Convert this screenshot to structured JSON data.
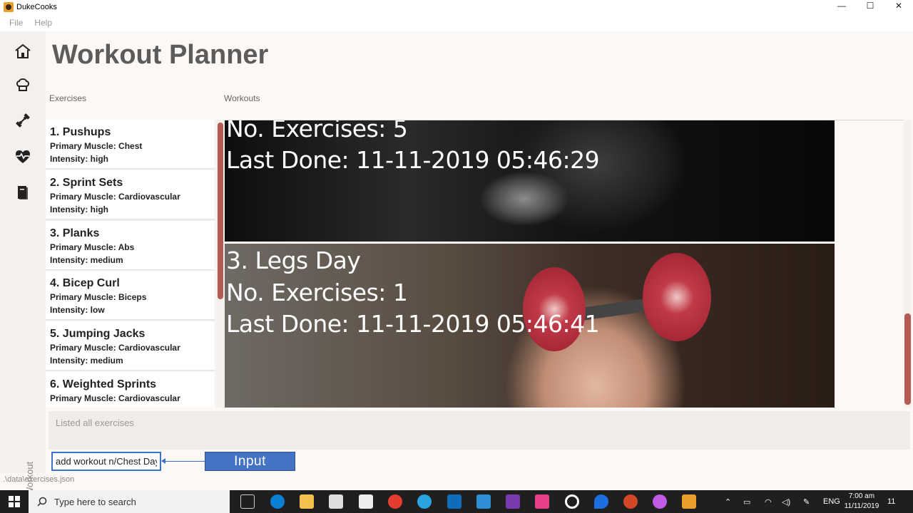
{
  "window": {
    "title": "DukeCooks",
    "minimize": "—",
    "maximize": "☐",
    "close": "✕"
  },
  "menu": {
    "file": "File",
    "help": "Help"
  },
  "sidebar": {
    "vertical_label": "Workout"
  },
  "page": {
    "title": "Workout Planner",
    "exercises_label": "Exercises",
    "workouts_label": "Workouts"
  },
  "exercises": [
    {
      "title": "1.  Pushups",
      "muscle": "Primary Muscle: Chest",
      "intensity": "Intensity: high"
    },
    {
      "title": "2.  Sprint Sets",
      "muscle": "Primary Muscle: Cardiovascular",
      "intensity": "Intensity: high"
    },
    {
      "title": "3.  Planks",
      "muscle": "Primary Muscle: Abs",
      "intensity": "Intensity: medium"
    },
    {
      "title": "4.  Bicep Curl",
      "muscle": "Primary Muscle: Biceps",
      "intensity": "Intensity: low"
    },
    {
      "title": "5.  Jumping Jacks",
      "muscle": "Primary Muscle: Cardiovascular",
      "intensity": "Intensity: medium"
    },
    {
      "title": "6.  Weighted Sprints",
      "muscle": "Primary Muscle: Cardiovascular",
      "intensity": ""
    }
  ],
  "workouts": [
    {
      "title": "",
      "exercises": "No. Exercises: 5",
      "last_done": "Last Done: 11-11-2019 05:46:29"
    },
    {
      "title": "3. Legs Day",
      "exercises": "No. Exercises: 1",
      "last_done": "Last Done: 11-11-2019 05:46:41"
    }
  ],
  "result": "Listed all exercises",
  "command": {
    "value": "add workout n/Chest Day"
  },
  "callout": "Input",
  "status": {
    "path": ".\\data\\exercises.json"
  },
  "taskbar": {
    "search_placeholder": "Type here to search",
    "language": "ENG",
    "time": "7:00 am",
    "date": "11/11/2019",
    "notification_count": "11"
  }
}
